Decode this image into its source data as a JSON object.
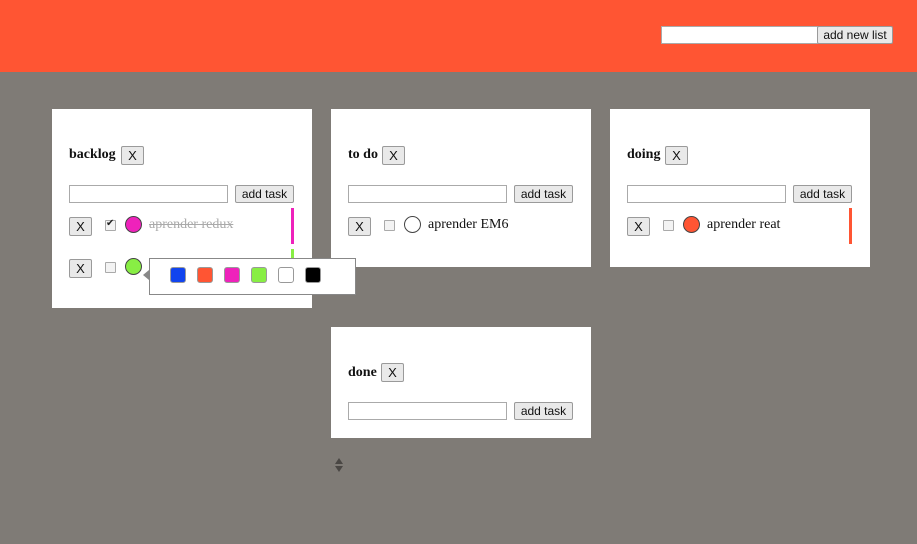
{
  "header": {
    "new_list_input_value": "",
    "add_list_label": "add new list",
    "accent_color": "#ff5533"
  },
  "lists": [
    {
      "title": "backlog",
      "close_label": "X",
      "task_input_value": "",
      "add_task_label": "add task",
      "tasks": [
        {
          "delete_label": "X",
          "checked": true,
          "color": "#ee22bb",
          "text": "aprender redux"
        },
        {
          "delete_label": "X",
          "checked": false,
          "color": "#88ee44",
          "text": ""
        }
      ]
    },
    {
      "title": "to do",
      "close_label": "X",
      "task_input_value": "",
      "add_task_label": "add task",
      "tasks": [
        {
          "delete_label": "X",
          "checked": false,
          "color": "#ffffff",
          "text": "aprender EM6"
        }
      ]
    },
    {
      "title": "doing",
      "close_label": "X",
      "task_input_value": "",
      "add_task_label": "add task",
      "tasks": [
        {
          "delete_label": "X",
          "checked": false,
          "color": "#ff5533",
          "text": "aprender reat"
        }
      ]
    },
    {
      "title": "done",
      "close_label": "X",
      "task_input_value": "",
      "add_task_label": "add task",
      "tasks": []
    }
  ],
  "color_palette": [
    "#1144ee",
    "#ff5533",
    "#ee22bb",
    "#88ee44",
    "#ffffff",
    "#000000"
  ],
  "background_color": "#7f7b76"
}
